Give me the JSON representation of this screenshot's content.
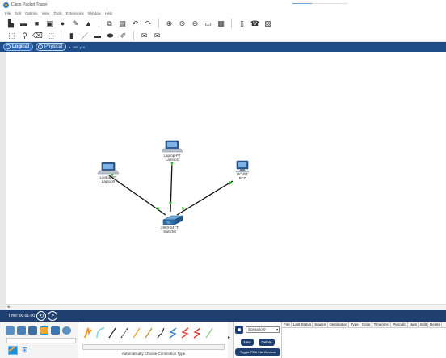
{
  "window": {
    "title": "Cisco Packet Tracer"
  },
  "menu": [
    "File",
    "Edit",
    "Options",
    "View",
    "Tools",
    "Extensions",
    "Window",
    "Help"
  ],
  "view": {
    "logical_label": "Logical",
    "physical_label": "Physical",
    "coords": "x: 400, y: 0"
  },
  "devices": {
    "laptop0": {
      "model": "Laptop-PT",
      "name": "Laptop0"
    },
    "laptop1": {
      "model": "Laptop-PT",
      "name": "Laptop1"
    },
    "pc0": {
      "model": "PC-PT",
      "name": "PC0"
    },
    "switch0": {
      "model": "2960-24TT",
      "name": "Switch0"
    }
  },
  "link_light_color": "#3cc43c",
  "time": {
    "label": "Time: 00:01:00"
  },
  "connections": {
    "caption": "Automatically Choose Connection Type"
  },
  "scenario": {
    "selected": "Scenario 0",
    "new_label": "New",
    "delete_label": "Delete",
    "toggle_label": "Toggle PDU List Window"
  },
  "pdu_columns": [
    "Fire",
    "Last Status",
    "Source",
    "Destination",
    "Type",
    "Color",
    "Time(sec)",
    "Periodic",
    "Num",
    "Edit",
    "Delete"
  ],
  "colors": {
    "time_bar": "#1e3f6f",
    "view_bar": "#1e4d8a",
    "accent": "#1f8cd8"
  }
}
